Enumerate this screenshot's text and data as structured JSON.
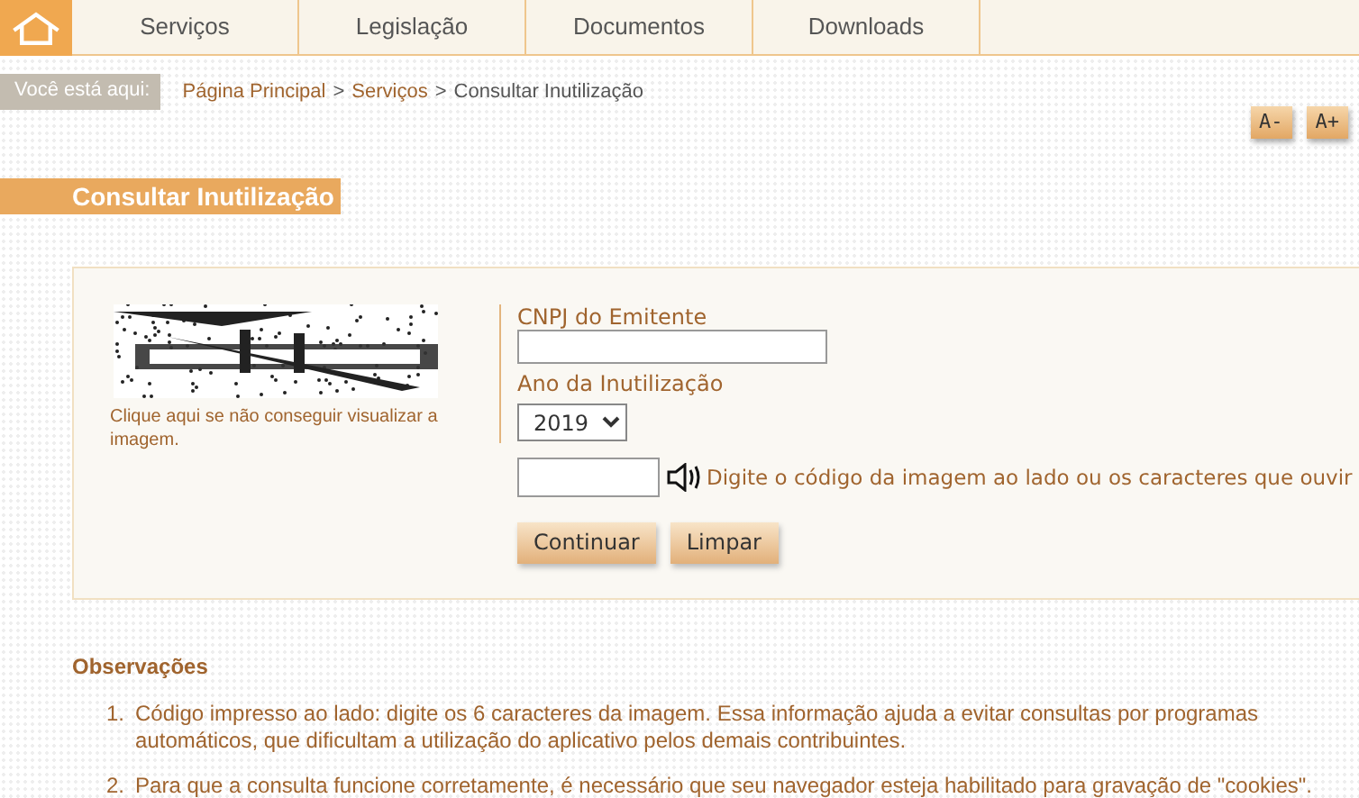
{
  "nav": {
    "tabs": [
      {
        "label": "Serviços"
      },
      {
        "label": "Legislação"
      },
      {
        "label": "Documentos"
      },
      {
        "label": "Downloads"
      }
    ]
  },
  "breadcrumb": {
    "label": "Você está aqui:",
    "items": [
      {
        "text": "Página Principal",
        "link": true
      },
      {
        "text": "Serviços",
        "link": true
      },
      {
        "text": "Consultar Inutilização",
        "link": false
      }
    ],
    "separator": ">"
  },
  "font_buttons": [
    "A-",
    "A+"
  ],
  "page_title": "Consultar Inutilização",
  "form": {
    "captcha": {
      "kind": "picture",
      "help_link": "Clique aqui se não conseguir visualizar a imagem."
    },
    "cnpj_label": "CNPJ do Emitente",
    "year_label": "Ano da Inutilização",
    "year_value": "2019",
    "code_hint": "Digite o código da imagem ao lado ou os caracteres que ouvir",
    "buttons": [
      "Continuar",
      "Limpar"
    ]
  },
  "observations": {
    "title": "Observações",
    "items": [
      {
        "number": "1.",
        "text": "Código impresso ao lado: digite os 6 caracteres da imagem. Essa informação ajuda a evitar consultas por programas automáticos, que dificultam a utilização do aplicativo pelos demais contribuintes."
      },
      {
        "number": "2.",
        "text": "Para que a consulta funcione corretamente, é necessário que seu navegador esteja habilitado para gravação de \"cookies\"."
      }
    ]
  }
}
